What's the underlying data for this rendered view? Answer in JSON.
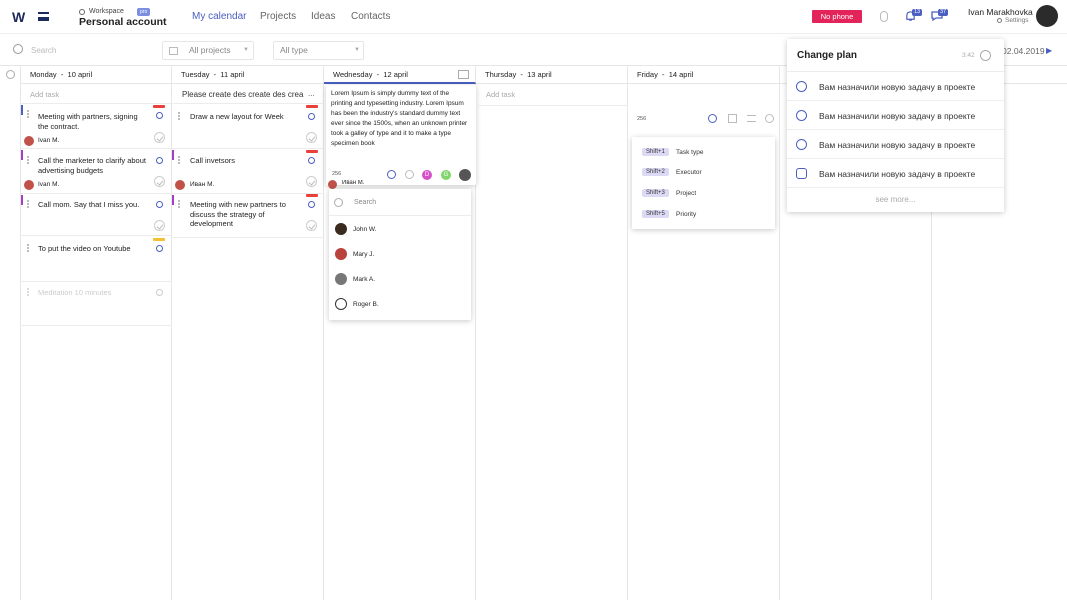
{
  "brand": {
    "logo": "W"
  },
  "workspace": {
    "label": "Workspace",
    "badge": "pro",
    "name": "Personal account"
  },
  "nav": [
    {
      "label": "My calendar",
      "active": true
    },
    {
      "label": "Projects"
    },
    {
      "label": "Ideas"
    },
    {
      "label": "Contacts"
    }
  ],
  "header": {
    "no_phone": "No phone",
    "notifications_count": "13",
    "messages_count": "37",
    "user_name": "Ivan Marakhovka",
    "settings_label": "Settings"
  },
  "filters": {
    "search_placeholder": "Search",
    "projects": "All projects",
    "type": "All type",
    "date": "02.04.2019"
  },
  "days": [
    {
      "weekday": "Monday",
      "date": "10 april"
    },
    {
      "weekday": "Tuesday",
      "date": "11 april"
    },
    {
      "weekday": "Wednesday",
      "date": "12 april"
    },
    {
      "weekday": "Thursday",
      "date": "13 april"
    },
    {
      "weekday": "Friday",
      "date": "14 april"
    }
  ],
  "add_task": "Add task",
  "monday": {
    "tasks": [
      {
        "text": "Meeting with partners, signing the contract.",
        "assignee": "Ivan M."
      },
      {
        "text": "Call the marketer to clarify about advertising budgets",
        "assignee": "Ivan M."
      },
      {
        "text": "Call mom. Say that I miss you."
      },
      {
        "text": "To put the video on Youtube"
      },
      {
        "text": "Meditation 10 minutes"
      }
    ]
  },
  "tuesday": {
    "input_value": "Please create des create des crea",
    "more": "...",
    "tasks": [
      {
        "text": "Draw a new layout for Week"
      },
      {
        "text": "Call invetsors",
        "assignee": "Иван М."
      },
      {
        "text": "Meeting with new partners to discuss the strategy of development"
      }
    ]
  },
  "wednesday_popup": {
    "description": "Lorem Ipsum is simply dummy text of the printing and typesetting industry. Lorem Ipsum has been the industry's standard dummy text ever since the 1500s, when an unknown printer took a galley of type and  it to make a type specimen book",
    "char_count": "256",
    "chips": [
      "D",
      "G"
    ],
    "assignee_hint": "Иван М.",
    "search_placeholder": "Search",
    "people": [
      "John W.",
      "Mary J.",
      "Mark A.",
      "Roger B."
    ]
  },
  "friday_popup": {
    "char_count": "256",
    "shortcuts": [
      {
        "key": "Shift+1",
        "label": "Task type"
      },
      {
        "key": "Shift+2",
        "label": "Executor"
      },
      {
        "key": "Shift+3",
        "label": "Project"
      },
      {
        "key": "Shift+5",
        "label": "Priority"
      }
    ]
  },
  "change_plan": {
    "title": "Change plan",
    "time": "3:42",
    "items": [
      {
        "text": "Вам назначили новую задачу в проекте",
        "icon": "bulb-icon"
      },
      {
        "text": "Вам назначили новую задачу в проекте",
        "icon": "clock-icon"
      },
      {
        "text": "Вам назначили новую задачу в проекте",
        "icon": "clock-icon"
      },
      {
        "text": "Вам назначили новую задачу в проекте",
        "icon": "gear-icon"
      }
    ],
    "see_more": "see more..."
  },
  "colors": {
    "accent": "#4a5fc1",
    "alert": "#e3245a",
    "flag_red": "#e8403a",
    "flag_yellow": "#f2c233"
  }
}
